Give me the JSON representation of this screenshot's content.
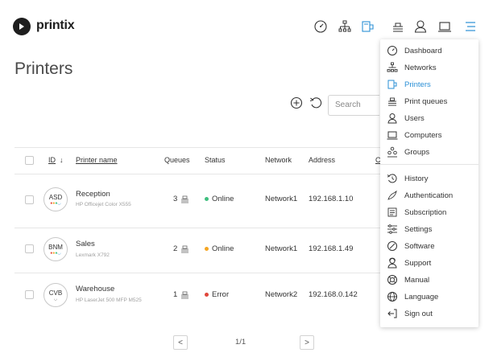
{
  "app": {
    "logo_text": "printix"
  },
  "colors": {
    "accent": "#2a8fd6",
    "online": "#3fbf7f",
    "warning": "#f5a623",
    "error": "#e0463a"
  },
  "topnav": {
    "icons": [
      "dashboard-icon",
      "network-icon",
      "printers-icon",
      "print-queues-icon",
      "users-icon",
      "computers-icon",
      "menu-icon"
    ]
  },
  "page": {
    "title": "Printers"
  },
  "toolbar": {
    "search_placeholder": "Search"
  },
  "table": {
    "headers": {
      "id": "ID",
      "sort_arrow": "↓",
      "name": "Printer name",
      "queues": "Queues",
      "status": "Status",
      "network": "Network",
      "address": "Address",
      "partial": "C"
    },
    "rows": [
      {
        "id": "ASD",
        "name": "Reception",
        "model": "HP Officejet Color X555",
        "queues": "3",
        "status": "Online",
        "status_color": "#3fbf7f",
        "network": "Network1",
        "address": "192.168.1.10"
      },
      {
        "id": "BNM",
        "name": "Sales",
        "model": "Lexmark X792",
        "queues": "2",
        "status": "Online",
        "status_color": "#f5a623",
        "network": "Network1",
        "address": "192.168.1.49"
      },
      {
        "id": "CVB",
        "name": "Warehouse",
        "model": "HP LaserJet 500 MFP M525",
        "queues": "1",
        "status": "Error",
        "status_color": "#e0463a",
        "network": "Network2",
        "address": "192.168.0.142"
      }
    ]
  },
  "pager": {
    "prev": "<",
    "text": "1/1",
    "next": ">"
  },
  "menu": {
    "items": [
      {
        "label": "Dashboard",
        "icon": "dashboard-icon"
      },
      {
        "label": "Networks",
        "icon": "network-icon"
      },
      {
        "label": "Printers",
        "icon": "printers-icon",
        "active": true
      },
      {
        "label": "Print queues",
        "icon": "print-queues-icon"
      },
      {
        "label": "Users",
        "icon": "users-icon"
      },
      {
        "label": "Computers",
        "icon": "computers-icon"
      },
      {
        "label": "Groups",
        "icon": "groups-icon"
      },
      {
        "label": "History",
        "icon": "history-icon"
      },
      {
        "label": "Authentication",
        "icon": "authentication-icon"
      },
      {
        "label": "Subscription",
        "icon": "subscription-icon"
      },
      {
        "label": "Settings",
        "icon": "settings-icon"
      },
      {
        "label": "Software",
        "icon": "software-icon"
      },
      {
        "label": "Support",
        "icon": "support-icon"
      },
      {
        "label": "Manual",
        "icon": "manual-icon"
      },
      {
        "label": "Language",
        "icon": "language-icon"
      },
      {
        "label": "Sign out",
        "icon": "sign-out-icon"
      }
    ]
  }
}
